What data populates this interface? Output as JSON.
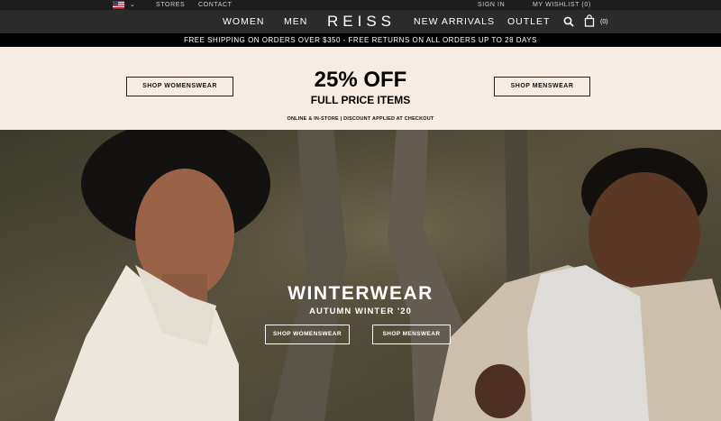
{
  "utility_bar": {
    "country_flag": "us-flag-icon",
    "stores": "STORES",
    "contact": "CONTACT",
    "sign_in": "SIGN IN",
    "wishlist": "MY WISHLIST (0)"
  },
  "nav": {
    "women": "WOMEN",
    "men": "MEN",
    "logo": "REISS",
    "new_arrivals": "NEW ARRIVALS",
    "outlet": "OUTLET",
    "bag_count": "(0)"
  },
  "shipping_bar": {
    "text": "FREE SHIPPING ON ORDERS OVER $350 - FREE RETURNS ON ALL ORDERS UP TO 28 DAYS"
  },
  "promo": {
    "shop_womenswear": "SHOP WOMENSWEAR",
    "shop_menswear": "SHOP MENSWEAR",
    "headline": "25% OFF",
    "subheadline": "FULL PRICE ITEMS",
    "note": "ONLINE & IN-STORE | DISCOUNT APPLIED AT CHECKOUT",
    "background_color": "#f6ece3"
  },
  "hero": {
    "title": "WINTERWEAR",
    "subtitle": "AUTUMN WINTER '20",
    "shop_womenswear": "SHOP WOMENSWEAR",
    "shop_menswear": "SHOP MENSWEAR"
  },
  "colors": {
    "utility_bar": "#1d1d1d",
    "nav_bar": "#2b2b2b",
    "shipping_bar": "#000000"
  }
}
